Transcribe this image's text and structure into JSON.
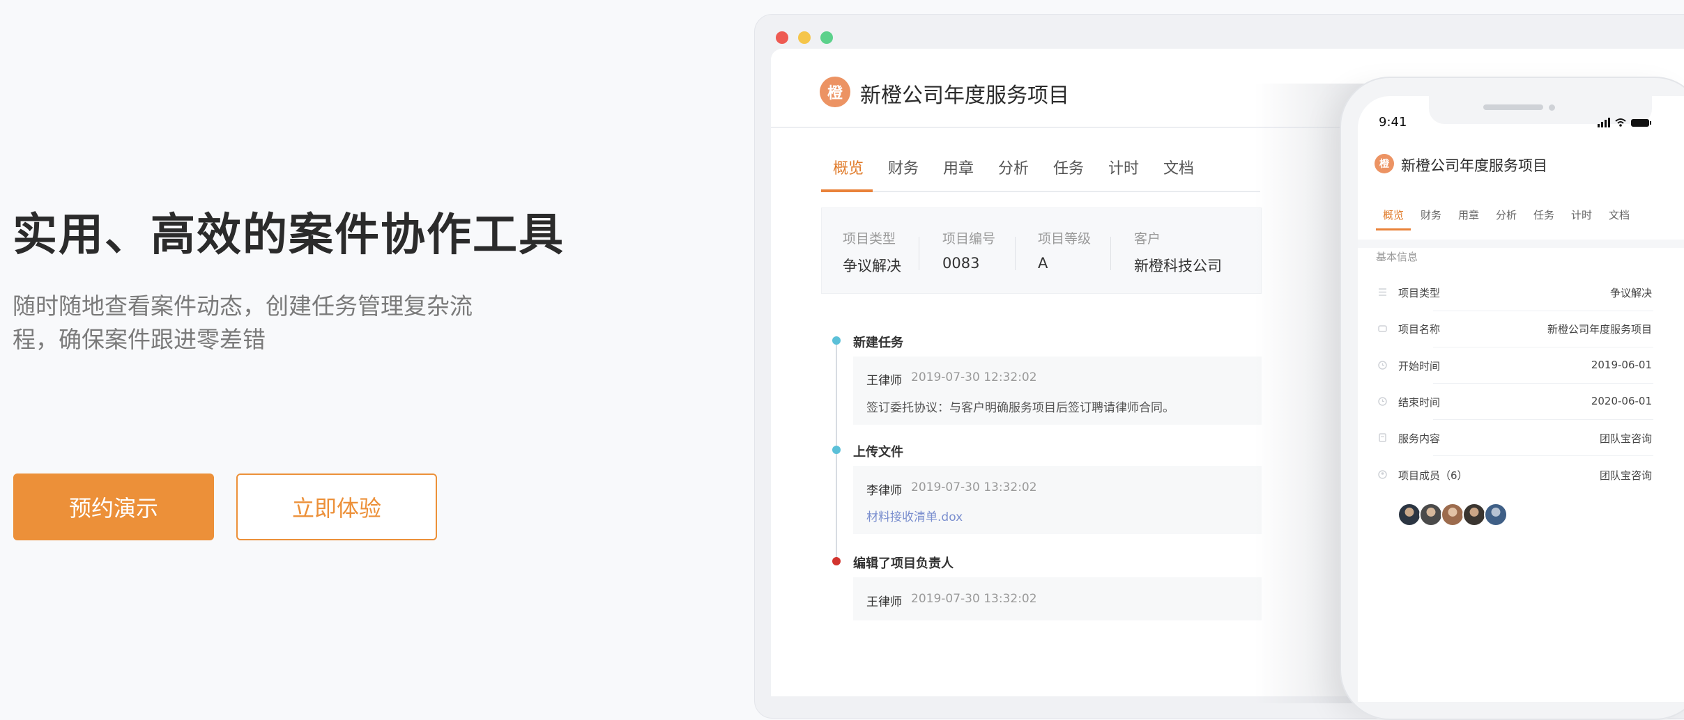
{
  "hero": {
    "title": "实用、高效的案件协作工具",
    "subtitle": "随时随地查看案件动态，创建任务管理复杂流程，确保案件跟进零差错",
    "primary_button": "预约演示",
    "secondary_button": "立即体验"
  },
  "colors": {
    "accent": "#ec9039",
    "timeline_blue": "#5bc0d8",
    "timeline_red": "#d2342e"
  },
  "desktop": {
    "logo_char": "橙",
    "project_title": "新橙公司年度服务项目",
    "tabs": [
      "概览",
      "财务",
      "用章",
      "分析",
      "任务",
      "计时",
      "文档"
    ],
    "active_tab": "概览",
    "info": [
      {
        "label": "项目类型",
        "value": "争议解决"
      },
      {
        "label": "项目编号",
        "value": "0083"
      },
      {
        "label": "项目等级",
        "value": "A"
      },
      {
        "label": "客户",
        "value": "新橙科技公司"
      }
    ],
    "timeline": [
      {
        "title": "新建任务",
        "user": "王律师",
        "time": "2019-07-30 12:32:02",
        "detail": "签订委托协议：与客户明确服务项目后签订聘请律师合同。"
      },
      {
        "title": "上传文件",
        "user": "李律师",
        "time": "2019-07-30 13:32:02",
        "link": "材料接收清单.dox"
      },
      {
        "title": "编辑了项目负责人",
        "user": "王律师",
        "time": "2019-07-30 13:32:02"
      }
    ]
  },
  "mobile": {
    "time": "9:41",
    "logo_char": "橙",
    "project_title": "新橙公司年度服务项目",
    "tabs": [
      "概览",
      "财务",
      "用章",
      "分析",
      "任务",
      "计时",
      "文档"
    ],
    "section": "基本信息",
    "rows": [
      {
        "label": "项目类型",
        "value": "争议解决",
        "icon": "list-icon"
      },
      {
        "label": "项目名称",
        "value": "新橙公司年度服务项目",
        "icon": "folder-icon"
      },
      {
        "label": "开始时间",
        "value": "2019-06-01",
        "icon": "clock-icon"
      },
      {
        "label": "结束时间",
        "value": "2020-06-01",
        "icon": "clock-icon"
      },
      {
        "label": "服务内容",
        "value": "团队宝咨询",
        "icon": "document-icon"
      },
      {
        "label": "项目成员（6）",
        "value": "团队宝咨询",
        "icon": "members-icon"
      }
    ],
    "member_count": 5
  }
}
